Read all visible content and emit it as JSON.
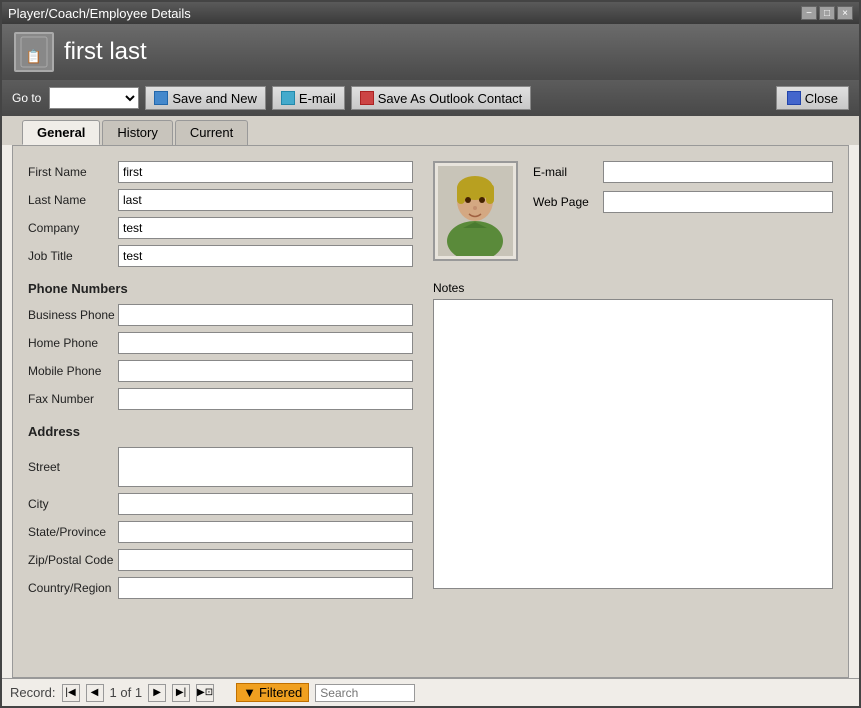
{
  "window": {
    "title": "Player/Coach/Employee Details",
    "titlebar_btns": [
      "−",
      "□",
      "×"
    ]
  },
  "header": {
    "icon": "👤",
    "title": "first last"
  },
  "toolbar": {
    "goto_label": "Go to",
    "goto_placeholder": "",
    "save_new_label": "Save and New",
    "email_label": "E-mail",
    "save_outlook_label": "Save As Outlook Contact",
    "close_label": "Close"
  },
  "tabs": [
    {
      "id": "general",
      "label": "General",
      "active": true
    },
    {
      "id": "history",
      "label": "History",
      "active": false
    },
    {
      "id": "current",
      "label": "Current",
      "active": false
    }
  ],
  "form": {
    "first_name_label": "First Name",
    "first_name_value": "first",
    "last_name_label": "Last Name",
    "last_name_value": "last",
    "company_label": "Company",
    "company_value": "test",
    "job_title_label": "Job Title",
    "job_title_value": "test",
    "phone_section_title": "Phone Numbers",
    "business_phone_label": "Business Phone",
    "business_phone_value": "",
    "home_phone_label": "Home Phone",
    "home_phone_value": "",
    "mobile_phone_label": "Mobile Phone",
    "mobile_phone_value": "",
    "fax_number_label": "Fax Number",
    "fax_number_value": "",
    "address_section_title": "Address",
    "street_label": "Street",
    "street_value": "",
    "city_label": "City",
    "city_value": "",
    "state_label": "State/Province",
    "state_value": "",
    "zip_label": "Zip/Postal Code",
    "zip_value": "",
    "country_label": "Country/Region",
    "country_value": "",
    "email_label": "E-mail",
    "email_value": "",
    "web_page_label": "Web Page",
    "web_page_value": "",
    "notes_label": "Notes",
    "notes_value": ""
  },
  "status_bar": {
    "record_label": "Record:",
    "first_btn": "⏮",
    "prev_btn": "◀",
    "record_info": "1 of 1",
    "next_btn": "▶",
    "last_btn": "⏭",
    "extra_btn": "⏭",
    "filter_icon": "▼",
    "filtered_label": "Filtered",
    "search_label": "Search"
  }
}
